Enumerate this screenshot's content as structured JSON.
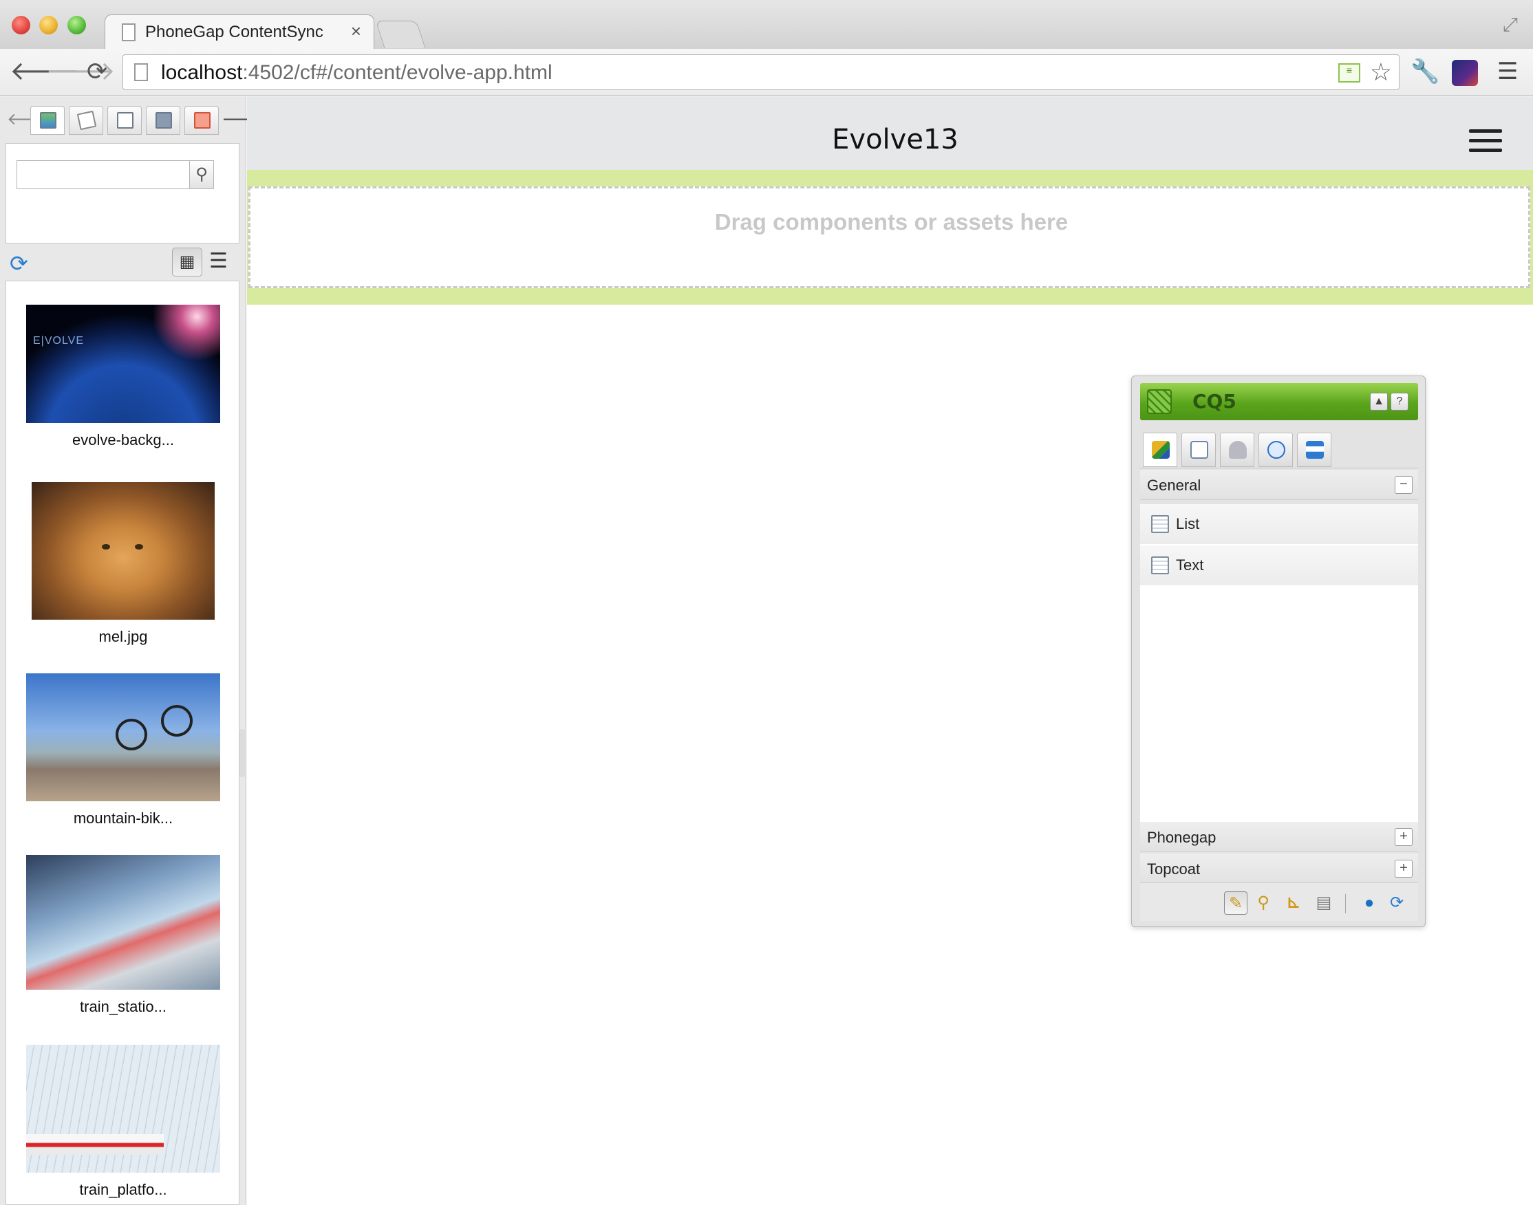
{
  "browser": {
    "tab_title": "PhoneGap ContentSync",
    "tab_close": "×",
    "url_host": "localhost",
    "url_path": ":4502/cf#/content/evolve-app.html",
    "icons": [
      "back-arrow-icon",
      "forward-arrow-icon",
      "reload-icon",
      "page-icon",
      "rss-icon",
      "star-icon",
      "wrench-icon",
      "extension-icon",
      "menu-icon",
      "fullscreen-icon"
    ]
  },
  "contentfinder": {
    "tabs": [
      "images",
      "pages",
      "documents",
      "movies",
      "scene7"
    ],
    "search": {
      "value": "",
      "placeholder": ""
    },
    "assets": [
      {
        "name": "evolve-backg..."
      },
      {
        "name": "mel.jpg"
      },
      {
        "name": "mountain-bik..."
      },
      {
        "name": "train_statio..."
      },
      {
        "name": "train_platfo..."
      }
    ],
    "earth_logo_text": "E|VOLVE"
  },
  "app": {
    "title": "Evolve13",
    "dropzone_text": "Drag components or assets here",
    "accent_color": "#d7ea9e"
  },
  "sidekick": {
    "title": "CQ5",
    "up_symbol": "▲",
    "help_symbol": "?",
    "sections": {
      "general": {
        "label": "General",
        "toggle": "−"
      },
      "phonegap": {
        "label": "Phonegap",
        "toggle": "+"
      },
      "topcoat": {
        "label": "Topcoat",
        "toggle": "+"
      }
    },
    "components": [
      {
        "label": "List"
      },
      {
        "label": "Text"
      }
    ],
    "brand_color": "#5aa51b"
  }
}
